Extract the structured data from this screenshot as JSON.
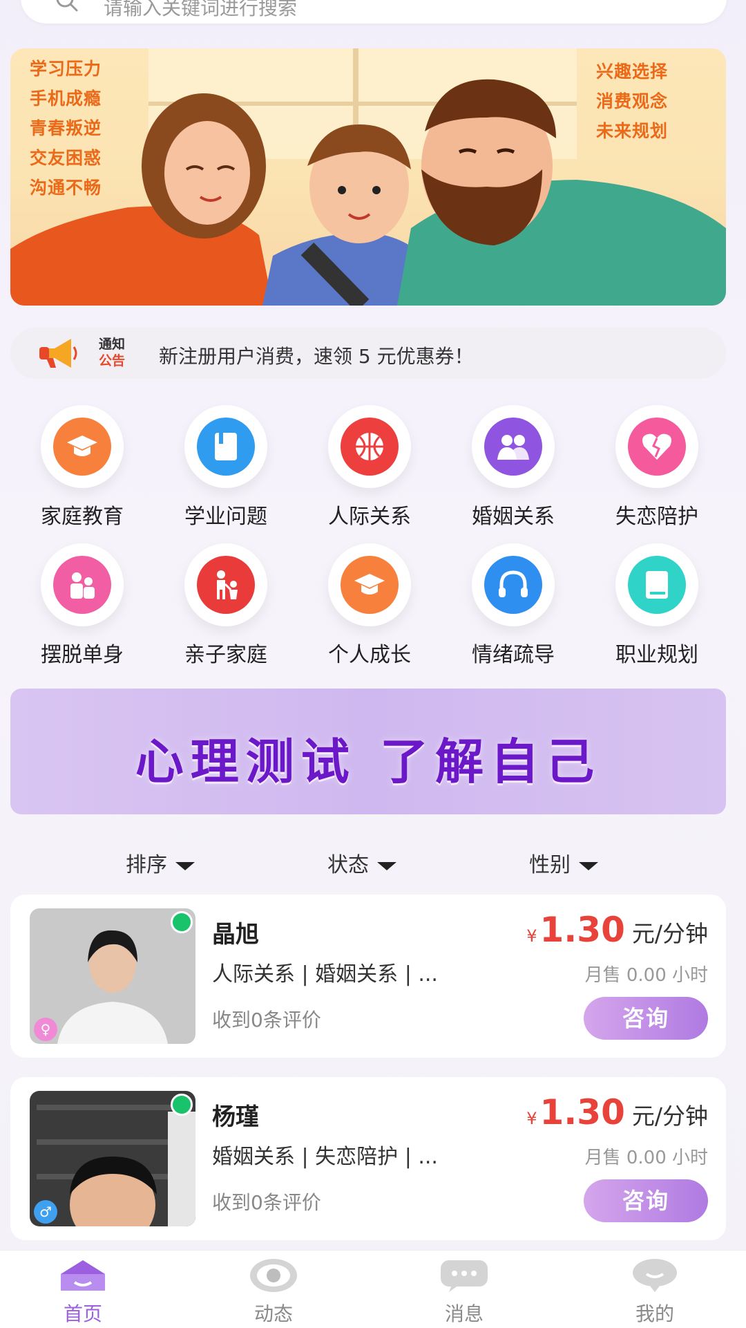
{
  "search": {
    "placeholder": "请输入关键词进行搜索"
  },
  "hero": {
    "left_keywords": [
      "学习压力",
      "手机成瘾",
      "青春叛逆",
      "交友困惑",
      "沟通不畅"
    ],
    "right_keywords": [
      "兴趣选择",
      "消费观念",
      "未来规划"
    ]
  },
  "notice": {
    "tag_top": "通知",
    "tag_bottom": "公告",
    "text": "新注册用户消费，速领 5 元优惠券！"
  },
  "categories": [
    {
      "label": "家庭教育",
      "icon": "graduation-cap-icon",
      "color": "#f7813c"
    },
    {
      "label": "学业问题",
      "icon": "book-icon",
      "color": "#2f9cf0"
    },
    {
      "label": "人际关系",
      "icon": "basketball-icon",
      "color": "#ee3f3f"
    },
    {
      "label": "婚姻关系",
      "icon": "couple-icon",
      "color": "#8f55e0"
    },
    {
      "label": "失恋陪护",
      "icon": "broken-heart-icon",
      "color": "#f45a9c"
    },
    {
      "label": "摆脱单身",
      "icon": "people-icon",
      "color": "#f25ea3"
    },
    {
      "label": "亲子家庭",
      "icon": "parent-child-icon",
      "color": "#ea3b3b"
    },
    {
      "label": "个人成长",
      "icon": "graduation-cap-icon",
      "color": "#f7813c"
    },
    {
      "label": "情绪疏导",
      "icon": "headphones-icon",
      "color": "#2f8ff0"
    },
    {
      "label": "职业规划",
      "icon": "book-icon",
      "color": "#2fd3c7"
    }
  ],
  "test_banner": {
    "text": "心理测试 了解自己"
  },
  "filters": [
    {
      "label": "排序"
    },
    {
      "label": "状态"
    },
    {
      "label": "性别"
    }
  ],
  "counselors": [
    {
      "name": "晶旭",
      "tags": "人际关系 | 婚姻关系 | ...",
      "currency": "¥",
      "price": "1.30",
      "unit": "元/分钟",
      "sold": "月售 0.00 小时",
      "reviews": "收到0条评价",
      "button": "咨询",
      "gender_icon": "female-icon",
      "gender_color": "#f08ad6"
    },
    {
      "name": "杨瑾",
      "tags": "婚姻关系 | 失恋陪护 | ...",
      "currency": "¥",
      "price": "1.30",
      "unit": "元/分钟",
      "sold": "月售 0.00 小时",
      "reviews": "收到0条评价",
      "button": "咨询",
      "gender_icon": "male-icon",
      "gender_color": "#3fa0f0"
    }
  ],
  "nav": [
    {
      "label": "首页",
      "icon": "home-icon",
      "active": true
    },
    {
      "label": "动态",
      "icon": "eye-icon",
      "active": false
    },
    {
      "label": "消息",
      "icon": "chat-icon",
      "active": false
    },
    {
      "label": "我的",
      "icon": "profile-icon",
      "active": false
    }
  ]
}
